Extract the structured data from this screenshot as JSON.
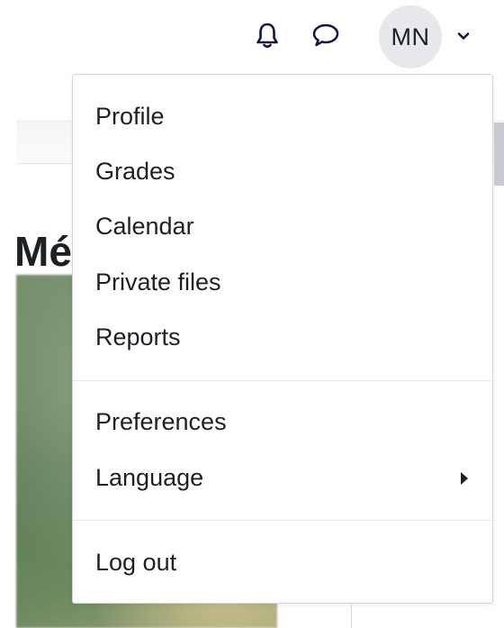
{
  "navbar": {
    "bell_icon": "bell-icon",
    "chat_icon": "speech-bubble-icon",
    "user_initials": "MN",
    "chevron_icon": "chevron-down-icon",
    "accent_color": "#0f1341"
  },
  "background": {
    "heading_fragment": "Mé"
  },
  "user_menu": {
    "items": [
      {
        "label": "Profile"
      },
      {
        "label": "Grades"
      },
      {
        "label": "Calendar"
      },
      {
        "label": "Private files"
      },
      {
        "label": "Reports"
      },
      {
        "label": "Preferences"
      },
      {
        "label": "Language",
        "submenu_icon": "caret-right-icon"
      },
      {
        "label": "Log out"
      }
    ]
  }
}
